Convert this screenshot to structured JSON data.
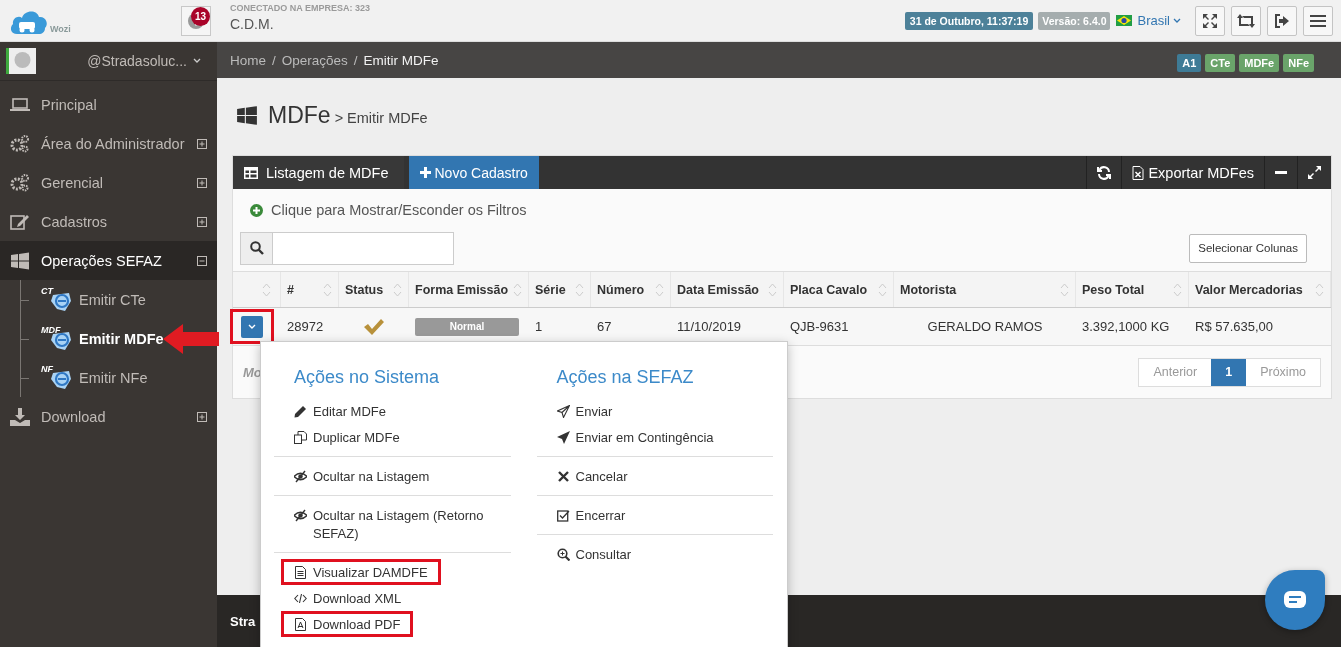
{
  "header": {
    "logo_text": "Wozi",
    "notifications": "13",
    "company_label": "CONECTADO NA EMPRESA: 323",
    "company_name": "C.D.M.",
    "datetime": "31 de Outubro, 11:37:19",
    "version": "Versão: 6.4.0",
    "language": "Brasil"
  },
  "sidebar": {
    "user": "@Stradasoluc...",
    "items": [
      {
        "label": "Principal",
        "expandable": false,
        "expanded": false,
        "selected": false
      },
      {
        "label": "Área do Administrador",
        "expandable": true,
        "expanded": false,
        "selected": false
      },
      {
        "label": "Gerencial",
        "expandable": true,
        "expanded": false,
        "selected": false
      },
      {
        "label": "Cadastros",
        "expandable": true,
        "expanded": false,
        "selected": false
      },
      {
        "label": "Operações SEFAZ",
        "expandable": true,
        "expanded": true,
        "selected": false,
        "children": [
          {
            "label": "Emitir CTe",
            "icon_label": "CT",
            "selected": false,
            "annotated": false
          },
          {
            "label": "Emitir MDFe",
            "icon_label": "MDF",
            "selected": true,
            "annotated": true
          },
          {
            "label": "Emitir NFe",
            "icon_label": "NF",
            "selected": false,
            "annotated": false
          }
        ]
      },
      {
        "label": "Download",
        "expandable": true,
        "expanded": false,
        "selected": false
      }
    ]
  },
  "breadcrumb": [
    {
      "label": "Home",
      "separator": "/"
    },
    {
      "label": "Operações",
      "separator": "/"
    },
    {
      "label": "Emitir MDFe"
    }
  ],
  "badges": [
    {
      "label": "A1",
      "color": "#3e7b96"
    },
    {
      "label": "CTe",
      "color": "#6aa46a"
    },
    {
      "label": "MDFe",
      "color": "#6aa46a"
    },
    {
      "label": "NFe",
      "color": "#6aa46a"
    }
  ],
  "page_title": {
    "title": "MDFe",
    "subtitle": "> Emitir MDFe"
  },
  "widget": {
    "title": "Listagem de MDFe",
    "new_button": "Novo Cadastro",
    "export_button": "Exportar MDFes",
    "filters_toggle": "Clique para Mostrar/Esconder os Filtros",
    "columns_button": "Selecionar Colunas"
  },
  "table": {
    "columns": [
      "#",
      "Status",
      "Forma Emissão",
      "Série",
      "Número",
      "Data Emissão",
      "Placa Cavalo",
      "Motorista",
      "Peso Total",
      "Valor Mercadorias"
    ],
    "rows": [
      {
        "expanded": true,
        "highlighted": true,
        "number": "28972",
        "status_ok": true,
        "forma": "Normal",
        "serie": "1",
        "numero": "67",
        "data": "11/10/2019",
        "placa": "QJB-9631",
        "motorista": "GERALDO RAMOS",
        "peso": "3.392,1000 KG",
        "valor": "R$ 57.635,00"
      }
    ]
  },
  "table_footer": {
    "info": "Mo",
    "pagination": [
      {
        "label": "Anterior",
        "selected": false
      },
      {
        "label": "1",
        "selected": true
      },
      {
        "label": "Próximo",
        "selected": false
      }
    ]
  },
  "dropdown": {
    "columns": [
      {
        "title": "Ações no Sistema",
        "groups": [
          [
            {
              "label": "Editar MDFe",
              "highlighted": false
            },
            {
              "label": "Duplicar MDFe",
              "highlighted": false
            }
          ],
          [
            {
              "label": "Ocultar na Listagem",
              "highlighted": false
            }
          ],
          [
            {
              "label": "Ocultar na Listagem (Retorno SEFAZ)",
              "highlighted": false
            }
          ],
          [
            {
              "label": "Visualizar DAMDFE",
              "highlighted": true
            },
            {
              "label": "Download XML",
              "highlighted": false
            },
            {
              "label": "Download PDF",
              "highlighted": true
            }
          ]
        ]
      },
      {
        "title": "Ações na SEFAZ",
        "groups": [
          [
            {
              "label": "Enviar",
              "highlighted": false
            },
            {
              "label": "Enviar em Contingência",
              "highlighted": false
            }
          ],
          [
            {
              "label": "Cancelar",
              "highlighted": false
            }
          ],
          [
            {
              "label": "Encerrar",
              "highlighted": false
            }
          ],
          [
            {
              "label": "Consultar",
              "highlighted": false
            }
          ]
        ]
      }
    ]
  },
  "page_footer": {
    "text": "Stra"
  }
}
